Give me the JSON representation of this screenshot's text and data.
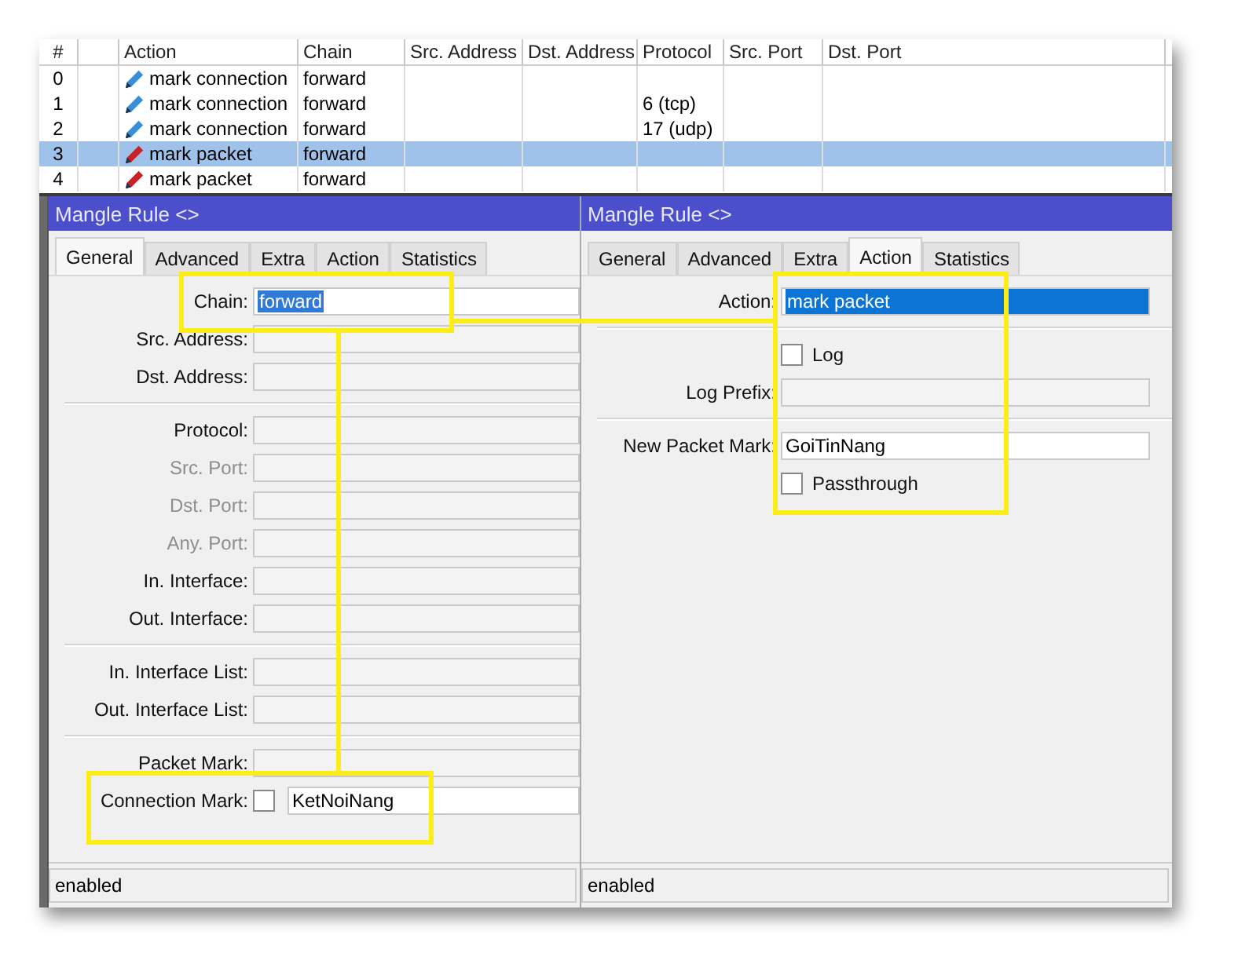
{
  "rules_table": {
    "columns": [
      "#",
      "Action",
      "Chain",
      "Src. Address",
      "Dst. Address",
      "Protocol",
      "Src. Port",
      "Dst. Port"
    ],
    "rows": [
      {
        "number": "0",
        "action": "mark connection",
        "kind": "connection",
        "chain": "forward",
        "selected": false
      },
      {
        "number": "1",
        "action": "mark connection",
        "kind": "connection",
        "chain": "forward",
        "protocol": "6 (tcp)",
        "selected": false
      },
      {
        "number": "2",
        "action": "mark connection",
        "kind": "connection",
        "chain": "forward",
        "protocol": "17 (udp)",
        "selected": false
      },
      {
        "number": "3",
        "action": "mark packet",
        "kind": "packet",
        "chain": "forward",
        "selected": true
      },
      {
        "number": "4",
        "action": "mark packet",
        "kind": "packet",
        "chain": "forward",
        "selected": false
      }
    ]
  },
  "dialogs": [
    {
      "title": "Mangle Rule <>",
      "tabs": [
        {
          "label": "General",
          "selected": true
        },
        {
          "label": "Advanced",
          "selected": false
        },
        {
          "label": "Extra",
          "selected": false
        },
        {
          "label": "Action",
          "selected": false
        },
        {
          "label": "Statistics",
          "selected": false
        }
      ],
      "fields": [
        {
          "kind": "text",
          "label": "Chain:",
          "value": "forward",
          "value_selected": true,
          "disabled": false,
          "highlighted": true
        },
        {
          "kind": "text",
          "label": "Src. Address:",
          "disabled": false
        },
        {
          "kind": "text",
          "label": "Dst. Address:",
          "disabled": false
        },
        {
          "kind": "separator"
        },
        {
          "kind": "text",
          "label": "Protocol:",
          "disabled": false
        },
        {
          "kind": "text",
          "label": "Src. Port:",
          "disabled": true
        },
        {
          "kind": "text",
          "label": "Dst. Port:",
          "disabled": true
        },
        {
          "kind": "text",
          "label": "Any. Port:",
          "disabled": true
        },
        {
          "kind": "text",
          "label": "In. Interface:",
          "disabled": false
        },
        {
          "kind": "text",
          "label": "Out. Interface:",
          "disabled": false
        },
        {
          "kind": "separator"
        },
        {
          "kind": "text",
          "label": "In. Interface List:",
          "disabled": false
        },
        {
          "kind": "text",
          "label": "Out. Interface List:",
          "disabled": false
        },
        {
          "kind": "separator"
        },
        {
          "kind": "text",
          "label": "Packet Mark:",
          "disabled": false
        },
        {
          "kind": "invertible",
          "label": "Connection Mark:",
          "checked": false,
          "value": "KetNoiNang",
          "disabled": false,
          "highlighted": true
        }
      ],
      "status": "enabled"
    },
    {
      "title": "Mangle Rule <>",
      "tabs": [
        {
          "label": "General",
          "selected": false
        },
        {
          "label": "Advanced",
          "selected": false
        },
        {
          "label": "Extra",
          "selected": false
        },
        {
          "label": "Action",
          "selected": true
        },
        {
          "label": "Statistics",
          "selected": false
        }
      ],
      "fields": [
        {
          "kind": "combo",
          "label": "Action:",
          "value": "mark packet",
          "value_selected": true,
          "disabled": false
        },
        {
          "kind": "separator"
        },
        {
          "kind": "checkbox",
          "label": "Log",
          "checked": false
        },
        {
          "kind": "text",
          "label": "Log Prefix:",
          "disabled": false
        },
        {
          "kind": "separator"
        },
        {
          "kind": "text",
          "label": "New Packet Mark:",
          "value": "GoiTinNang",
          "disabled": false
        },
        {
          "kind": "checkbox",
          "label": "Passthrough",
          "checked": false
        }
      ],
      "values_highlighted": true,
      "status": "enabled"
    }
  ]
}
